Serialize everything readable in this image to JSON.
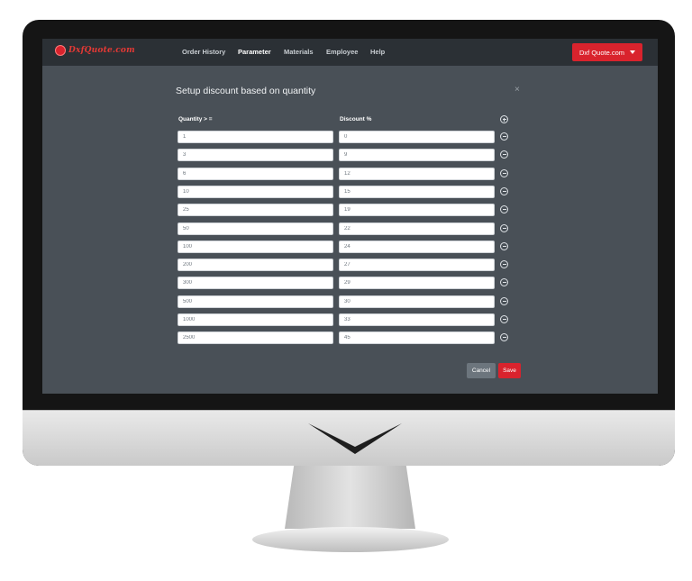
{
  "brand": {
    "logo_text": "DxfQuote.com",
    "accent_color": "#d9232d"
  },
  "nav": {
    "items": [
      {
        "label": "Order History",
        "active": false
      },
      {
        "label": "Parameter",
        "active": true
      },
      {
        "label": "Materials",
        "active": false
      },
      {
        "label": "Employee",
        "active": false
      },
      {
        "label": "Help",
        "active": false
      }
    ],
    "user_button": "Dxf Quote.com"
  },
  "modal": {
    "title": "Setup discount based on quantity",
    "close_icon": "close-icon",
    "columns": {
      "quantity": "Quantity > =",
      "discount": "Discount %"
    },
    "add_icon": "plus-circle-icon",
    "remove_icon": "minus-circle-icon",
    "rows": [
      {
        "quantity": "1",
        "discount": "0"
      },
      {
        "quantity": "3",
        "discount": "9"
      },
      {
        "quantity": "6",
        "discount": "12"
      },
      {
        "quantity": "10",
        "discount": "15"
      },
      {
        "quantity": "25",
        "discount": "19"
      },
      {
        "quantity": "50",
        "discount": "22"
      },
      {
        "quantity": "100",
        "discount": "24"
      },
      {
        "quantity": "200",
        "discount": "27"
      },
      {
        "quantity": "300",
        "discount": "29"
      },
      {
        "quantity": "500",
        "discount": "30"
      },
      {
        "quantity": "1000",
        "discount": "33"
      },
      {
        "quantity": "2500",
        "discount": "45"
      }
    ],
    "cancel_label": "Cancel",
    "save_label": "Save"
  }
}
